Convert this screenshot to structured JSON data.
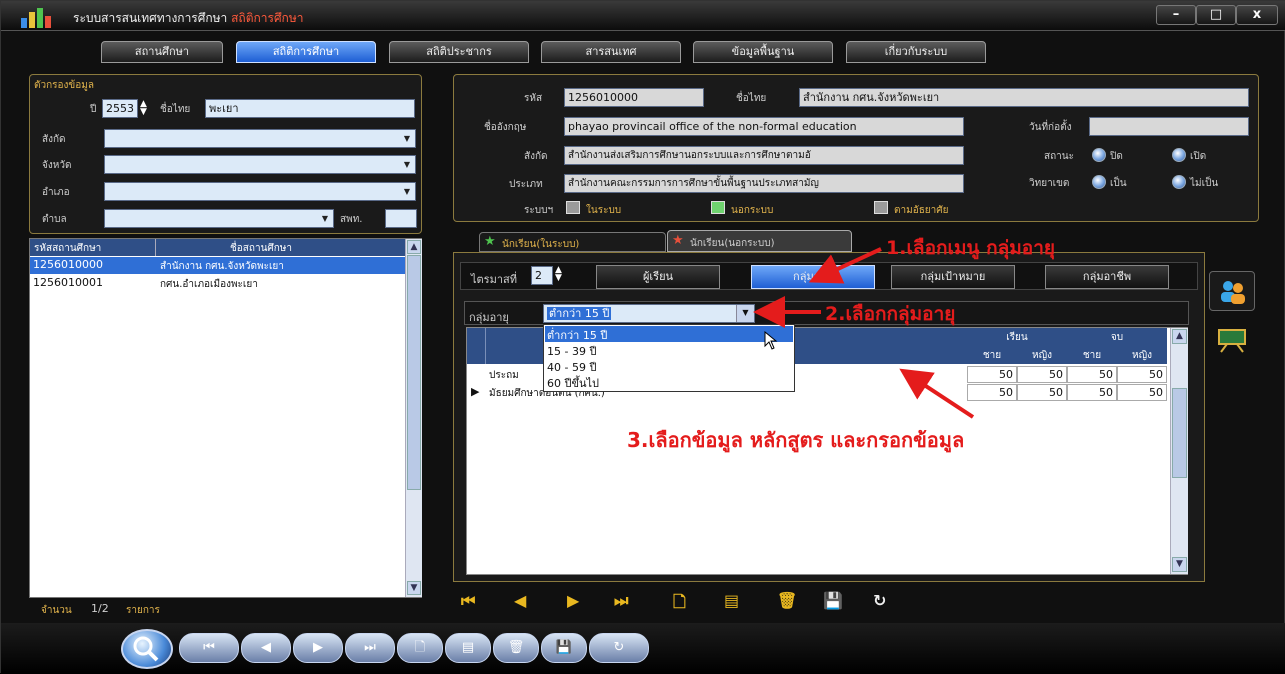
{
  "window": {
    "title": "ระบบสารสนเทศทางการศึกษา",
    "subtitle": "สถิติการศึกษา",
    "btn_min": "–",
    "btn_max": "□",
    "btn_close": "x"
  },
  "menu": [
    {
      "label": "สถานศึกษา"
    },
    {
      "label": "สถิติการศึกษา"
    },
    {
      "label": "สถิติประชากร"
    },
    {
      "label": "สารสนเทศ"
    },
    {
      "label": "ข้อมูลพื้นฐาน"
    },
    {
      "label": "เกี่ยวกับระบบ"
    }
  ],
  "filter": {
    "title": "ตัวกรองข้อมูล",
    "year_label": "ปี",
    "year_value": "2553",
    "thai_name_label": "ชื่อไทย",
    "thai_name_value": "พะเยา",
    "affiliation_label": "สังกัด",
    "province_label": "จังหวัด",
    "district_label": "อำเภอ",
    "subdistrict_label": "ตำบล",
    "postal_label": "สพท."
  },
  "school_list": {
    "col_code": "รหัสสถานศึกษา",
    "col_name": "ชื่อสถานศึกษา",
    "rows": [
      {
        "code": "1256010000",
        "name": "สำนักงาน กศน.จังหวัดพะเยา"
      },
      {
        "code": "1256010001",
        "name": "กศน.อำเภอเมืองพะเยา"
      }
    ],
    "count_label": "จำนวน",
    "count_value": "1/2",
    "count_unit": "รายการ"
  },
  "detail": {
    "code_label": "รหัส",
    "code_value": "1256010000",
    "thai_label": "ชื่อไทย",
    "thai_value": "สำนักงาน กศน.จังหวัดพะเยา",
    "en_label": "ชื่ออังกฤษ",
    "en_value": "phayao provincail office of the non-formal education",
    "founded_label": "วันที่ก่อตั้ง",
    "affil_label": "สังกัด",
    "affil_value": "สำนักงานส่งเสริมการศึกษานอกระบบและการศึกษาตามอั",
    "status_label": "สถานะ",
    "status_closed": "ปิด",
    "status_open": "เปิด",
    "type_label": "ประเภท",
    "type_value": "สำนักงานคณะกรรมการการศึกษาขั้นพื้นฐานประเภทสามัญ",
    "campus_label": "วิทยาเขต",
    "campus_yes": "เป็น",
    "campus_no": "ไม่เป็น",
    "system_label": "ระบบฯ",
    "sys_in": "ในระบบ",
    "sys_out": "นอกระบบ",
    "sys_self": "ตามอัธยาศัย"
  },
  "student_tabs": [
    "นักเรียน(ในระบบ)",
    "นักเรียน(นอกระบบ)"
  ],
  "sub_toolbar": {
    "quarter_label": "ไตรมาสที่",
    "quarter_value": "2",
    "buttons": [
      "ผู้เรียน",
      "กลุ่มอายุ",
      "กลุ่มเป้าหมาย",
      "กลุ่มอาชีพ"
    ]
  },
  "age_group": {
    "label": "กลุ่มอายุ",
    "selected": "ต่ำกว่า 15 ปี",
    "options": [
      "ต่ำกว่า 15 ปี",
      "15 - 39 ปี",
      "40 - 59 ปี",
      "60 ปีขึ้นไป"
    ]
  },
  "grid": {
    "study_header": "เรียน",
    "finish_header": "จบ",
    "male": "ชาย",
    "female": "หญิง",
    "rows": [
      {
        "name": "ประถม",
        "values": [
          "50",
          "50",
          "50",
          "50"
        ]
      },
      {
        "name": "มัธยมศึกษาตอนต้น (กศน.)",
        "values": [
          "50",
          "50",
          "50",
          "50"
        ]
      }
    ]
  },
  "annotations": {
    "step1": "1.เลือกเมนู กลุ่มอายุ",
    "step2": "2.เลือกกลุ่มอายุ",
    "step3": "3.เลือกข้อมูล หลักสูตร และกรอกข้อมูล"
  },
  "colors": {
    "accent": "#2f6fd6",
    "annotation": "#e41c1c",
    "panel_border": "#8b7a3e"
  }
}
